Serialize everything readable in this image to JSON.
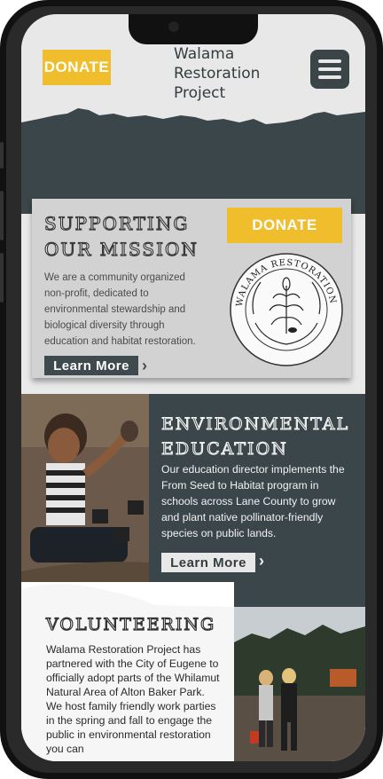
{
  "header": {
    "donate_label": "DONATE",
    "brand_line1": "Walama",
    "brand_line2": "Restoration",
    "brand_line3": "Project",
    "menu_icon": "hamburger-menu-icon"
  },
  "mission": {
    "title": "SUPPORTING OUR MISSION",
    "text": "We are a community organized non-profit, dedicated to environmental stewardship and biological diversity through education and habitat restoration.",
    "learn_more": "Learn More",
    "donate_label": "DONATE",
    "logo_text": "WALAMA RESTORATION PROJECT"
  },
  "environmental": {
    "title": "ENVIRONMENTAL EDUCATION",
    "text": "Our education director implements the From Seed to Habitat program in schools across Lane County to grow and plant native pollinator-friendly species on public lands.",
    "learn_more": "Learn More"
  },
  "volunteering": {
    "title": "VOLUNTEERING",
    "text": "Walama Restoration Project has partnered with the City of Eugene to officially adopt parts of the Whilamut Natural Area of Alton Baker Park. We host family friendly work parties in the spring and fall to engage the public in environmental restoration you can"
  },
  "colors": {
    "accent_yellow": "#f0bd2c",
    "dark_slate": "#3a4649",
    "light_gray": "#e8e8e8"
  }
}
